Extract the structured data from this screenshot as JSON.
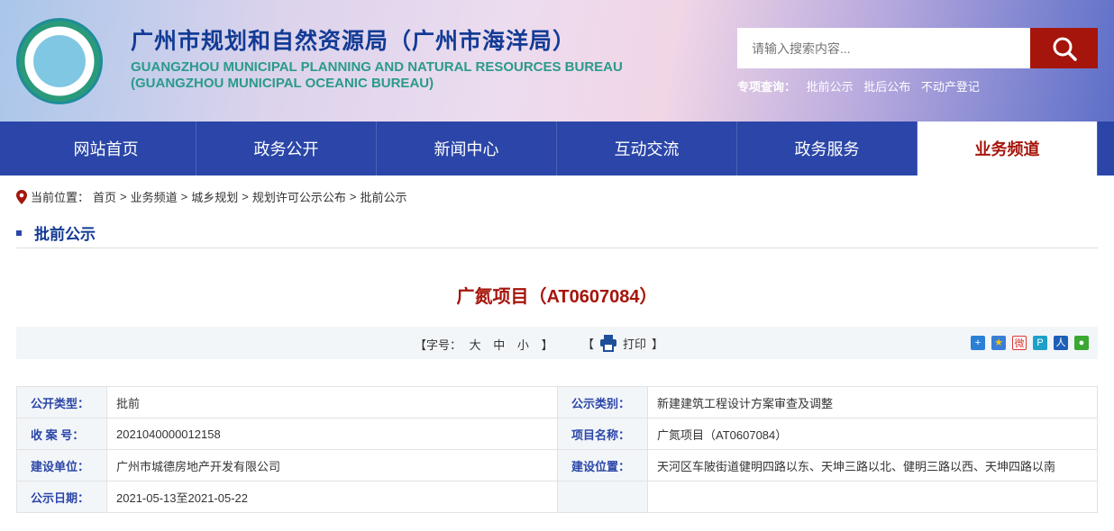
{
  "header": {
    "title_cn": "广州市规划和自然资源局（广州市海洋局）",
    "title_en_1": "GUANGZHOU MUNICIPAL PLANNING AND NATURAL RESOURCES BUREAU",
    "title_en_2": "(GUANGZHOU MUNICIPAL OCEANIC BUREAU)",
    "search_placeholder": "请输入搜索内容...",
    "quick_label": "专项查询：",
    "quick_links": [
      "批前公示",
      "批后公布",
      "不动产登记"
    ]
  },
  "nav": [
    "网站首页",
    "政务公开",
    "新闻中心",
    "互动交流",
    "政务服务",
    "业务频道"
  ],
  "breadcrumb": {
    "label": "当前位置：",
    "items": [
      "首页",
      "业务频道",
      "城乡规划",
      "规划许可公示公布",
      "批前公示"
    ],
    "sep": ">"
  },
  "section_title": "批前公示",
  "doc_title": "广氮项目（AT0607084）",
  "toolbar": {
    "font_open": "【字号：",
    "sizes": [
      "大",
      "中",
      "小"
    ],
    "font_close": "】",
    "print_open": "【",
    "print": "打印",
    "print_close": "】"
  },
  "info": [
    [
      "公开类型：",
      "批前",
      "公示类别：",
      "新建建筑工程设计方案审查及调整"
    ],
    [
      "收 案 号：",
      "2021040000012158",
      "项目名称：",
      "广氮项目（AT0607084）"
    ],
    [
      "建设单位：",
      "广州市城德房地产开发有限公司",
      "建设位置：",
      "天河区车陂街道健明四路以东、天坤三路以北、健明三路以西、天坤四路以南"
    ],
    [
      "公示日期：",
      "2021-05-13至2021-05-22",
      "",
      ""
    ]
  ]
}
